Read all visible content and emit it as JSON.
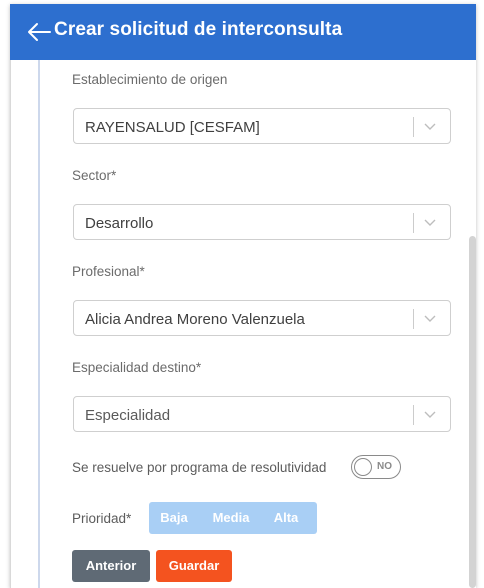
{
  "header": {
    "title": "Crear solicitud de interconsulta"
  },
  "form": {
    "origin": {
      "label": "Establecimiento de origen",
      "value": "RAYENSALUD [CESFAM]"
    },
    "sector": {
      "label": "Sector*",
      "value": "Desarrollo"
    },
    "professional": {
      "label": "Profesional*",
      "value": "Alicia Andrea Moreno Valenzuela"
    },
    "specialty": {
      "label": "Especialidad destino*",
      "placeholder": "Especialidad"
    },
    "resolution": {
      "label": "Se resuelve por programa de resolutividad",
      "toggle_text": "NO"
    },
    "priority": {
      "label": "Prioridad*",
      "options": [
        "Baja",
        "Media",
        "Alta"
      ]
    }
  },
  "actions": {
    "previous": "Anterior",
    "save": "Guardar"
  },
  "colors": {
    "header": "#2d6fcf",
    "save": "#f4531f",
    "previous": "#5f6a75",
    "priority": "#a9cff5"
  }
}
